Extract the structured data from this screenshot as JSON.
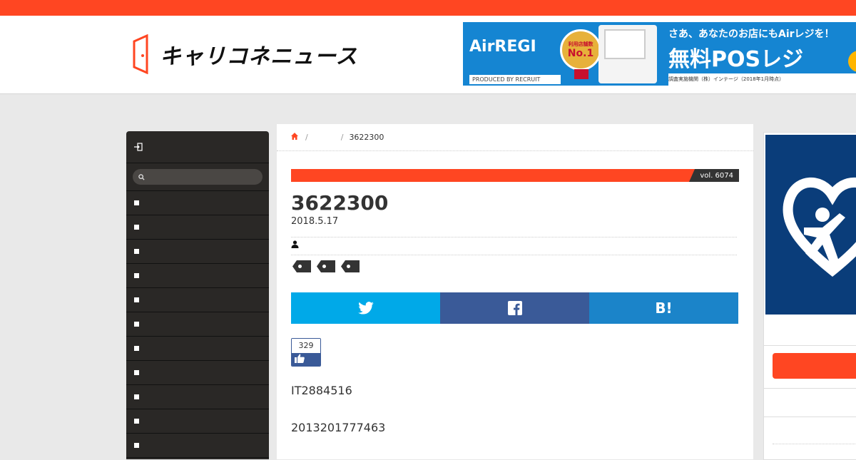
{
  "header": {
    "site_name": "キャリコネニュース",
    "logo_icon": "door-logo-icon"
  },
  "banner": {
    "brand": "AirREGI",
    "produced_by": "PRODUCED BY RECRUIT",
    "medal_small": "利用店舗数",
    "medal_big": "No.1",
    "tagline": "さあ、あなたのお店にもAirレジを！",
    "headline": "無料POSレジ",
    "note": "調査実施機関（株）インテージ（2018年1月時点）"
  },
  "sidebar": {
    "login_icon": "login-icon",
    "search_placeholder": "",
    "items": [
      "",
      "",
      "",
      "",
      "",
      "",
      "",
      "",
      "",
      "",
      ""
    ]
  },
  "breadcrumb": {
    "home_icon": "home-icon",
    "category": "",
    "current": "3622300"
  },
  "article": {
    "volume": "vol. 6074",
    "title": "3622300",
    "date": "2018.5.17",
    "author": "",
    "tags": [
      "",
      "",
      ""
    ],
    "like_count": "329",
    "paragraphs": [
      "IT2884516",
      "2013201777463"
    ]
  },
  "share": {
    "twitter_icon": "twitter-icon",
    "facebook_icon": "facebook-icon",
    "hatena_label": "B!"
  },
  "colors": {
    "accent": "#ff4622",
    "sidebar": "#2a2826",
    "twitter": "#00a9e8",
    "facebook": "#3a5a98",
    "hatena": "#1b84c9"
  }
}
